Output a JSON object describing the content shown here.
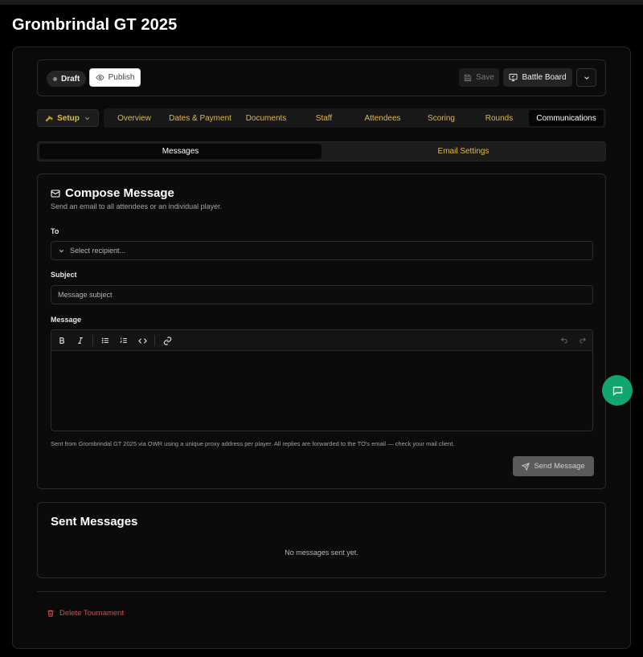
{
  "page": {
    "title": "Grombrindal GT 2025"
  },
  "header": {
    "status_badge": "Draft",
    "publish_label": "Publish",
    "save_label": "Save",
    "battle_board_label": "Battle Board"
  },
  "nav": {
    "setup_label": "Setup",
    "tabs": [
      {
        "label": "Overview"
      },
      {
        "label": "Dates & Payment"
      },
      {
        "label": "Documents"
      },
      {
        "label": "Staff"
      },
      {
        "label": "Attendees"
      },
      {
        "label": "Scoring"
      },
      {
        "label": "Rounds"
      },
      {
        "label": "Communications"
      }
    ],
    "active_tab": "Communications",
    "subtabs": [
      {
        "label": "Messages"
      },
      {
        "label": "Email Settings"
      }
    ]
  },
  "compose": {
    "title": "Compose Message",
    "subtitle": "Send an email to all attendees or an individual player.",
    "to_label": "To",
    "to_placeholder": "Select recipient...",
    "subject_label": "Subject",
    "subject_placeholder": "Message subject",
    "message_label": "Message",
    "helper_text": "Sent from Grombrindal GT 2025 via OWR using a unique proxy address per player. All replies are forwarded to the TO's email — check your mail client.",
    "send_label": "Send Message"
  },
  "sent": {
    "title": "Sent Messages",
    "empty_text": "No messages sent yet."
  },
  "danger": {
    "delete_label": "Delete Tournament"
  },
  "colors": {
    "accent": "#e2b93b",
    "danger": "#e5484d",
    "chat_fab": "#12a56f",
    "background": "#000000"
  },
  "icons": [
    "eye-icon",
    "save-icon",
    "monitor-icon",
    "chevron-down-icon",
    "wrench-icon",
    "mail-icon",
    "bold-icon",
    "italic-icon",
    "bullet-list-icon",
    "numbered-list-icon",
    "code-icon",
    "link-icon",
    "undo-icon",
    "redo-icon",
    "send-icon",
    "trash-icon",
    "chat-icon"
  ]
}
